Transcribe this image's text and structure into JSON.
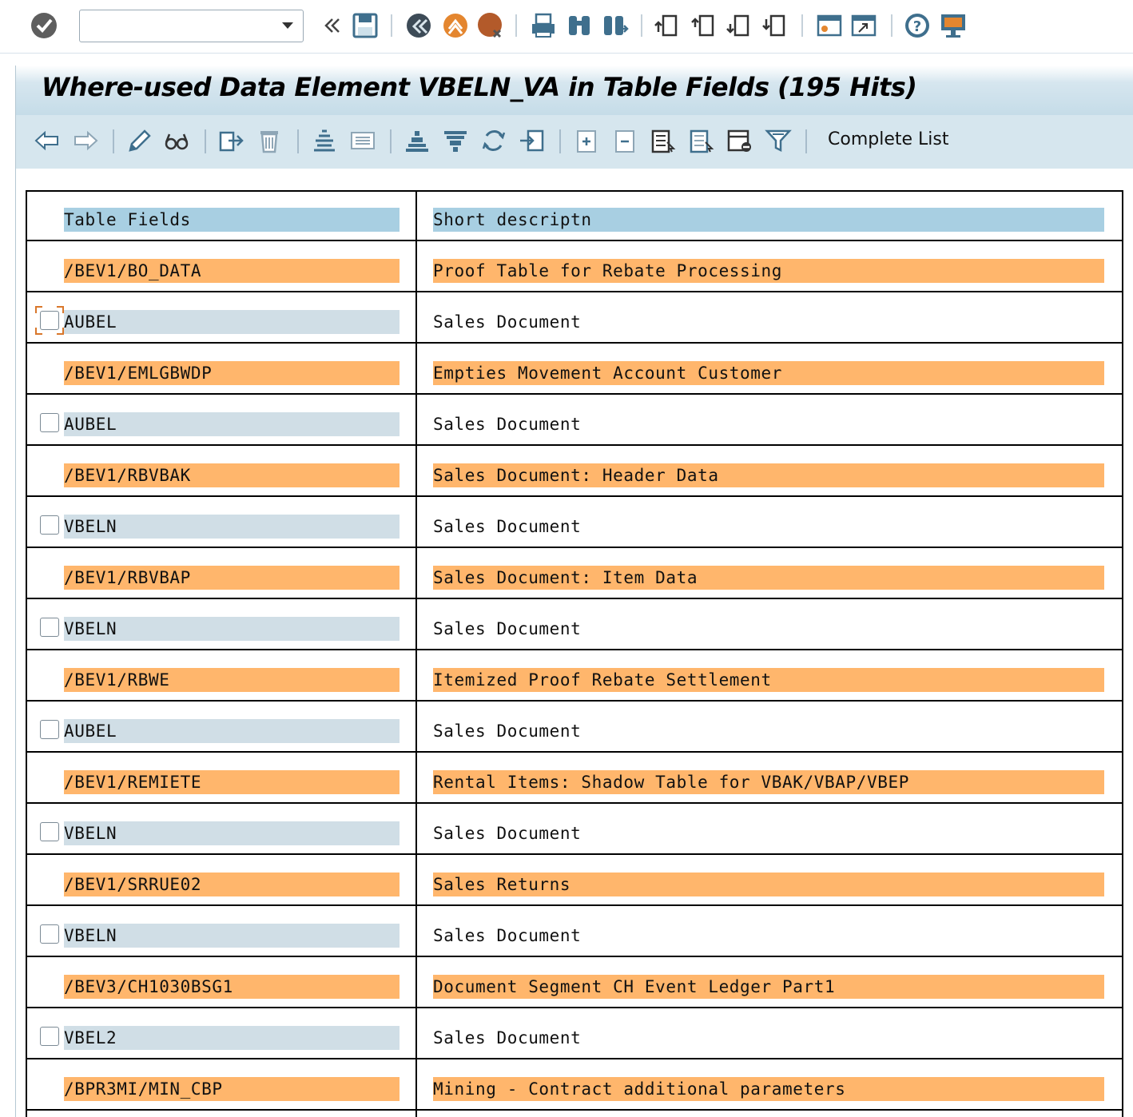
{
  "window": {
    "title": "Where-used Data Element VBELN_VA in Table Fields (195 Hits)",
    "command_field_value": ""
  },
  "app_toolbar": {
    "complete_list_label": "Complete List"
  },
  "colors": {
    "header_cell": "#a8cfe2",
    "table_row": "#ffb66c",
    "field_cell": "#d0dee6",
    "title_bar": "#c5dce8"
  },
  "table": {
    "headers": [
      "Table Fields",
      "Short descriptn"
    ],
    "rows": [
      {
        "kind": "table",
        "name": "/BEV1/BO_DATA",
        "desc": "Proof Table for Rebate Processing"
      },
      {
        "kind": "field",
        "name": "AUBEL",
        "desc": "Sales Document",
        "focused": true
      },
      {
        "kind": "table",
        "name": "/BEV1/EMLGBWDP",
        "desc": "Empties Movement Account Customer"
      },
      {
        "kind": "field",
        "name": "AUBEL",
        "desc": "Sales Document"
      },
      {
        "kind": "table",
        "name": "/BEV1/RBVBAK",
        "desc": "Sales Document: Header Data"
      },
      {
        "kind": "field",
        "name": "VBELN",
        "desc": "Sales Document"
      },
      {
        "kind": "table",
        "name": "/BEV1/RBVBAP",
        "desc": "Sales Document: Item Data"
      },
      {
        "kind": "field",
        "name": "VBELN",
        "desc": "Sales Document"
      },
      {
        "kind": "table",
        "name": "/BEV1/RBWE",
        "desc": "Itemized Proof Rebate Settlement"
      },
      {
        "kind": "field",
        "name": "AUBEL",
        "desc": "Sales Document"
      },
      {
        "kind": "table",
        "name": "/BEV1/REMIETE",
        "desc": "Rental Items: Shadow Table for VBAK/VBAP/VBEP"
      },
      {
        "kind": "field",
        "name": "VBELN",
        "desc": "Sales Document"
      },
      {
        "kind": "table",
        "name": "/BEV1/SRRUE02",
        "desc": "Sales Returns"
      },
      {
        "kind": "field",
        "name": "VBELN",
        "desc": "Sales Document"
      },
      {
        "kind": "table",
        "name": "/BEV3/CH1030BSG1",
        "desc": "Document Segment CH Event Ledger Part1"
      },
      {
        "kind": "field",
        "name": "VBEL2",
        "desc": "Sales Document"
      },
      {
        "kind": "table",
        "name": "/BPR3MI/MIN_CBP",
        "desc": "Mining - Contract additional parameters"
      }
    ]
  }
}
